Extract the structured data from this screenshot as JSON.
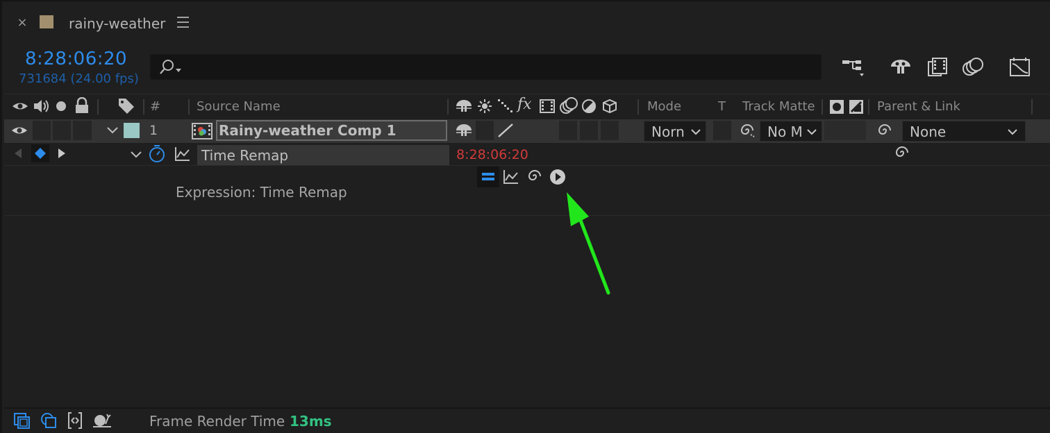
{
  "tab": {
    "close_glyph": "×",
    "title": "rainy-weather",
    "swatch_color": "#a28f6d",
    "menu_icon": "hamburger-menu-icon"
  },
  "time": {
    "timecode": "8:28:06:20",
    "frames": "731684 (24.00 fps)"
  },
  "search": {
    "placeholder": "",
    "icon": "search-icon"
  },
  "toolbar_icons": [
    "composition-flowchart-icon",
    "draft-3d-icon",
    "frame-blending-icon",
    "motion-blur-icon",
    "graph-editor-icon"
  ],
  "columns": {
    "number": "#",
    "source_name": "Source Name",
    "mode": "Mode",
    "t": "T",
    "track_matte": "Track Matte",
    "parent_link": "Parent & Link"
  },
  "layer": {
    "number": "1",
    "name": "Rainy-weather Comp 1",
    "label_color": "#9ac8c4",
    "mode": "Norn",
    "track_matte": "No M",
    "parent": "None"
  },
  "property": {
    "name": "Time Remap",
    "value": "8:28:06:20",
    "value_color": "#d23a3a"
  },
  "expression": {
    "label": "Expression: Time Remap",
    "controls": [
      "expression-enable-icon",
      "graph-icon",
      "pick-whip-icon",
      "language-menu-icon"
    ]
  },
  "footer": {
    "render_label": "Frame Render Time",
    "render_value": "13ms",
    "render_value_color": "#32c282"
  },
  "annotation": {
    "arrow_color": "#22e61c"
  }
}
